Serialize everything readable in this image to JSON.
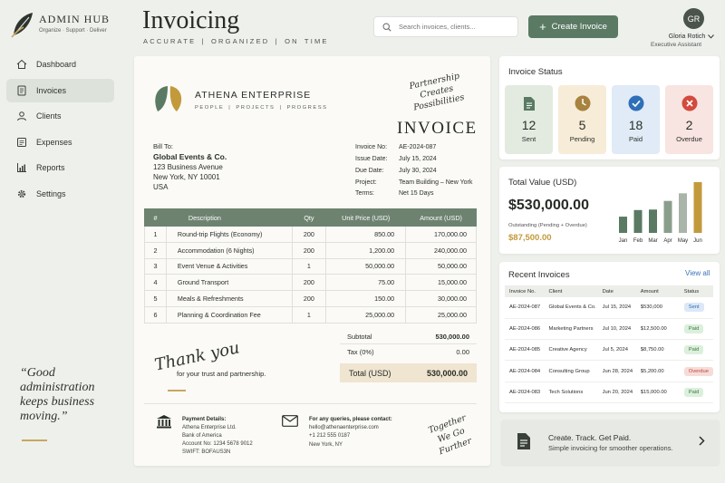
{
  "brand": {
    "title": "ADMIN HUB",
    "tagline": "Organize · Support · Deliver"
  },
  "sidebar": {
    "items": [
      {
        "label": "Dashboard",
        "icon": "home-icon"
      },
      {
        "label": "Invoices",
        "icon": "document-icon",
        "active": true
      },
      {
        "label": "Clients",
        "icon": "user-icon"
      },
      {
        "label": "Expenses",
        "icon": "receipt-icon"
      },
      {
        "label": "Reports",
        "icon": "bar-chart-icon"
      },
      {
        "label": "Settings",
        "icon": "gear-icon"
      }
    ],
    "quote": "“Good administration keeps business moving.”"
  },
  "header": {
    "title": "Invoicing",
    "tagline": "ACCURATE | ORGANIZED | ON TIME",
    "search_placeholder": "Search invoices, clients...",
    "create_label": "Create Invoice",
    "user": {
      "initials": "GR",
      "name": "Gloria Rotich",
      "role": "Executive Assistant"
    }
  },
  "invoice": {
    "company": "ATHENA ENTERPRISE",
    "company_tagline": "PEOPLE | PROJECTS | PROGRESS",
    "script_line1": "Partnership",
    "script_line2": "Creates Possibilities",
    "heading": "INVOICE",
    "bill_to": {
      "label": "Bill To:",
      "name": "Global Events & Co.",
      "address1": "123 Business Avenue",
      "address2": "New York, NY 10001",
      "country": "USA"
    },
    "meta": [
      {
        "key": "Invoice No:",
        "value": "AE-2024-087"
      },
      {
        "key": "Issue Date:",
        "value": "July 15, 2024"
      },
      {
        "key": "Due Date:",
        "value": "July 30, 2024"
      },
      {
        "key": "Project:",
        "value": "Team Building – New York"
      },
      {
        "key": "Terms:",
        "value": "Net 15 Days"
      }
    ],
    "columns": [
      "#",
      "Description",
      "Qty",
      "Unit Price (USD)",
      "Amount (USD)"
    ],
    "items": [
      {
        "n": "1",
        "desc": "Round-trip Flights (Economy)",
        "qty": "200",
        "unit": "850.00",
        "amount": "170,000.00"
      },
      {
        "n": "2",
        "desc": "Accommodation (6 Nights)",
        "qty": "200",
        "unit": "1,200.00",
        "amount": "240,000.00"
      },
      {
        "n": "3",
        "desc": "Event Venue & Activities",
        "qty": "1",
        "unit": "50,000.00",
        "amount": "50,000.00"
      },
      {
        "n": "4",
        "desc": "Ground Transport",
        "qty": "200",
        "unit": "75.00",
        "amount": "15,000.00"
      },
      {
        "n": "5",
        "desc": "Meals & Refreshments",
        "qty": "200",
        "unit": "150.00",
        "amount": "30,000.00"
      },
      {
        "n": "6",
        "desc": "Planning & Coordination Fee",
        "qty": "1",
        "unit": "25,000.00",
        "amount": "25,000.00"
      }
    ],
    "thank_you": "Thank you",
    "thank_you_sub": "for your trust and partnership.",
    "subtotal_label": "Subtotal",
    "subtotal": "530,000.00",
    "tax_label": "Tax (0%)",
    "tax": "0.00",
    "total_label": "Total (USD)",
    "total": "530,000.00",
    "payment": {
      "title": "Payment Details:",
      "lines": [
        "Athena Enterprise Ltd.",
        "Bank of America",
        "Account No: 1234 5678 9012",
        "SWIFT: BOFAUS3N"
      ]
    },
    "contact": {
      "title": "For any queries, please contact:",
      "lines": [
        "hello@athenaenterprise.com",
        "+1 212 555 0187",
        "New York, NY"
      ]
    },
    "footer_script1": "Together",
    "footer_script2": "We Go Further"
  },
  "invoice_status": {
    "title": "Invoice Status",
    "tiles": [
      {
        "count": "12",
        "label": "Sent",
        "icon": "document-icon",
        "bg": "#e3ebe1",
        "color": "#5a7a63"
      },
      {
        "count": "5",
        "label": "Pending",
        "icon": "clock-icon",
        "bg": "#f7ecd8",
        "color": "#a8823f"
      },
      {
        "count": "18",
        "label": "Paid",
        "icon": "check-icon",
        "bg": "#e0ebf7",
        "color": "#2f6fb8"
      },
      {
        "count": "2",
        "label": "Overdue",
        "icon": "x-icon",
        "bg": "#f8e4e1",
        "color": "#d24b3e"
      }
    ]
  },
  "total_value": {
    "title": "Total Value (USD)",
    "value": "$530,000.00",
    "sub": "Outstanding (Pending + Overdue)",
    "outstanding": "$87,500.00"
  },
  "chart_data": {
    "type": "bar",
    "categories": [
      "Jan",
      "Feb",
      "Mar",
      "Apr",
      "May",
      "Jun"
    ],
    "values": [
      0.32,
      0.45,
      0.46,
      0.63,
      0.78,
      1.0
    ],
    "colors": [
      "#5a7a63",
      "#5a7a63",
      "#5a7a63",
      "#8a9e8c",
      "#a8b5a8",
      "#c29a3c"
    ]
  },
  "recent": {
    "title": "Recent Invoices",
    "view_all": "View all",
    "columns": [
      "Invoice No.",
      "Client",
      "Date",
      "Amount",
      "Status"
    ],
    "rows": [
      {
        "no": "AE-2024-087",
        "client": "Global Events & Co.",
        "date": "Jul 15, 2024",
        "amount": "$530,000",
        "status": "Sent",
        "bg": "#dce8f6",
        "color": "#2f6fb8"
      },
      {
        "no": "AE-2024-086",
        "client": "Marketing Partners",
        "date": "Jul 10, 2024",
        "amount": "$12,500.00",
        "status": "Paid",
        "bg": "#dcefdc",
        "color": "#3d7a45"
      },
      {
        "no": "AE-2024-085",
        "client": "Creative Agency",
        "date": "Jul 5, 2024",
        "amount": "$8,750.00",
        "status": "Paid",
        "bg": "#dcefdc",
        "color": "#3d7a45"
      },
      {
        "no": "AE-2024-084",
        "client": "Consulting Group",
        "date": "Jun 28, 2024",
        "amount": "$5,200.00",
        "status": "Overdue",
        "bg": "#f6dcd8",
        "color": "#c5443a"
      },
      {
        "no": "AE-2024-083",
        "client": "Tech Solutions",
        "date": "Jun 20, 2024",
        "amount": "$15,000.00",
        "status": "Paid",
        "bg": "#dcefdc",
        "color": "#3d7a45"
      }
    ]
  },
  "cta": {
    "title": "Create. Track. Get Paid.",
    "sub": "Simple invoicing for smoother operations."
  }
}
